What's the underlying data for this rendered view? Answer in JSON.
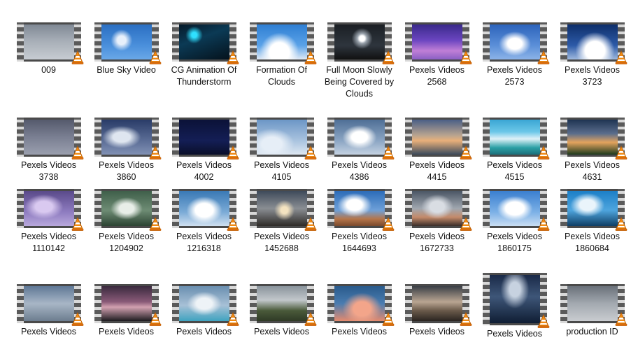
{
  "items": [
    {
      "label": "009",
      "bg": "linear-gradient(180deg,#7f8894 0%,#a6adb6 45%,#c7ccd2 100%)"
    },
    {
      "label": "Blue Sky Video",
      "bg": "radial-gradient(circle at 40% 45%,#e8f0fb 0 12%,transparent 30%),linear-gradient(180deg,#2b6fc2 0%,#4a8fdb 60%,#6aa8e8 100%)"
    },
    {
      "label": "CG Animation Of Thunderstorm",
      "bg": "radial-gradient(circle at 30% 30%,#2fe0ff 0 6%,transparent 20%),linear-gradient(160deg,#061a2a 0%,#0b3a55 40%,#05121c 100%)"
    },
    {
      "label": "Formation Of Clouds",
      "bg": "radial-gradient(ellipse at 45% 80%,#ffffff 0 25%,transparent 50%),linear-gradient(180deg,#2f7fd3 0%,#5aa2e8 60%,#dfe9f5 100%)"
    },
    {
      "label": "Full Moon Slowly Being Covered by Clouds",
      "bg": "radial-gradient(circle at 55% 40%,#ffffff 0 8%,#9aa3ad 14%,transparent 30%),linear-gradient(180deg,#1b1f24 0%,#2e353d 60%,#111 100%)"
    },
    {
      "label": "Pexels Videos 2568",
      "bg": "linear-gradient(180deg,#3a2a8a 0%,#6b45c0 45%,#c07fd6 75%,#8a5fc4 100%)"
    },
    {
      "label": "Pexels Videos 2573",
      "bg": "radial-gradient(ellipse at 50% 55%,#ffffff 0 20%,transparent 45%),linear-gradient(180deg,#2c63bb 0%,#5b8fd8 60%,#8cb3e8 100%)"
    },
    {
      "label": "Pexels Videos 3723",
      "bg": "radial-gradient(ellipse at 55% 75%,#ffffff 0 25%,transparent 50%),linear-gradient(180deg,#0e2f6b 0%,#2c5aa8 60%,#9fb9de 100%)"
    },
    {
      "label": "Pexels Videos 3738",
      "bg": "linear-gradient(180deg,#555a6c 0%,#7a7f92 50%,#9a9fae 100%)"
    },
    {
      "label": "Pexels Videos 3860",
      "bg": "radial-gradient(ellipse at 40% 50%,#dfe6f0 0 20%,transparent 45%),linear-gradient(180deg,#2a3c68 0%,#5b6d96 60%,#8191b4 100%)"
    },
    {
      "label": "Pexels Videos 4002",
      "bg": "linear-gradient(180deg,#0b1238 0%,#141e55 60%,#0a0f2a 100%)"
    },
    {
      "label": "Pexels Videos 4105",
      "bg": "radial-gradient(ellipse at 30% 70%,#e6eef7 0 20%,transparent 45%),linear-gradient(180deg,#6c96c6 0%,#a9c3df 60%,#dde7f1 100%)"
    },
    {
      "label": "Pexels Videos 4386",
      "bg": "radial-gradient(ellipse at 50% 50%,#ffffff 0 22%,transparent 48%),linear-gradient(180deg,#4f6f96 0%,#8ba5c3 60%,#c4d2e2 100%)"
    },
    {
      "label": "Pexels Videos 4415",
      "bg": "linear-gradient(180deg,#4a5f86 0%,#b9a48f 45%,#e9b07a 60%,#3b4a5c 100%)"
    },
    {
      "label": "Pexels Videos 4515",
      "bg": "linear-gradient(180deg,#3aa6d4 0%,#6cc7e8 35%,#dff1f8 55%,#2ca0a6 80%,#1b6f7a 100%)"
    },
    {
      "label": "Pexels Videos 4631",
      "bg": "linear-gradient(180deg,#1f3452 0%,#5a6d8c 40%,#e3a35d 65%,#1d3a1d 100%)"
    },
    {
      "label": "Pexels Videos 1110142",
      "bg": "radial-gradient(ellipse at 40% 45%,#d9c9f0 0 20%,transparent 45%),linear-gradient(180deg,#5a4a8a 0%,#8e7cc0 60%,#b8a8dc 100%)"
    },
    {
      "label": "Pexels Videos 1204902",
      "bg": "radial-gradient(ellipse at 50% 50%,#e8eee8 0 20%,transparent 45%),linear-gradient(180deg,#3f5f4a 0%,#6e8c74 55%,#2c4433 100%)"
    },
    {
      "label": "Pexels Videos 1216318",
      "bg": "radial-gradient(ellipse at 50% 55%,#ffffff 0 25%,transparent 50%),linear-gradient(180deg,#3a79b5 0%,#7aaad6 60%,#cfe0f0 100%)"
    },
    {
      "label": "Pexels Videos 1452688",
      "bg": "radial-gradient(circle at 55% 55%,#f4e3c0 0 10%,transparent 30%),linear-gradient(180deg,#3e4a5a 0%,#8a8e93 50%,#2e2b28 100%)"
    },
    {
      "label": "Pexels Videos 1644693",
      "bg": "radial-gradient(ellipse at 40% 40%,#ffffff 0 18%,transparent 40%),linear-gradient(180deg,#2c6cb8 0%,#6ea0d8 55%,#b5754a 80%,#7a4a2c 100%)"
    },
    {
      "label": "Pexels Videos 1672733",
      "bg": "radial-gradient(ellipse at 50% 45%,#d9dde3 0 20%,transparent 45%),linear-gradient(180deg,#4b5665 0%,#a0a7b0 50%,#c48a6a 75%,#3a2e2a 100%)"
    },
    {
      "label": "Pexels Videos 1860175",
      "bg": "radial-gradient(ellipse at 50% 50%,#ffffff 0 26%,transparent 50%),linear-gradient(180deg,#3b7fcf 0%,#7bb0e6 60%,#c9ddf2 100%)"
    },
    {
      "label": "Pexels Videos 1860684",
      "bg": "radial-gradient(ellipse at 40% 40%,#eaf4fb 0 18%,transparent 40%),linear-gradient(180deg,#1c7fc7 0%,#4ea5de 55%,#0f3f66 100%)"
    },
    {
      "label": "Pexels Videos",
      "bg": "linear-gradient(180deg,#5f7896 0%,#a8b6c6 50%,#6c7d8f 100%)"
    },
    {
      "label": "Pexels Videos",
      "bg": "linear-gradient(180deg,#3a2a3e 0%,#8a5a78 45%,#d2a0b0 60%,#1c1a1e 100%)"
    },
    {
      "label": "Pexels Videos",
      "bg": "radial-gradient(ellipse at 50% 50%,#eef3f7 0 22%,transparent 48%),linear-gradient(180deg,#6a8fb0 0%,#a7c0d6 55%,#3fa3c0 100%)"
    },
    {
      "label": "Pexels Videos",
      "bg": "linear-gradient(180deg,#8a949c 0%,#c2c7cb 40%,#4a5a3a 70%,#2f3a26 100%)"
    },
    {
      "label": "Pexels Videos",
      "bg": "radial-gradient(ellipse at 55% 65%,#f3a58a 0 22%,transparent 50%),linear-gradient(180deg,#2a5b8c 0%,#4a7cb0 50%,#e58a6e 100%)"
    },
    {
      "label": "Pexels Videos",
      "bg": "linear-gradient(180deg,#3a3f46 0%,#b9a592 45%,#6a5a4a 70%,#2a2420 100%)"
    },
    {
      "label": "Pexels Videos",
      "bg": "radial-gradient(ellipse at 50% 30%,#c7d2e0 0 15%,transparent 40%),linear-gradient(180deg,#1a2a48 0%,#3e5678 45%,#0f1d33 100%)"
    },
    {
      "label": "production ID",
      "bg": "linear-gradient(180deg,#6a717a 0%,#a3a9b0 50%,#c9ccd0 100%)"
    }
  ]
}
